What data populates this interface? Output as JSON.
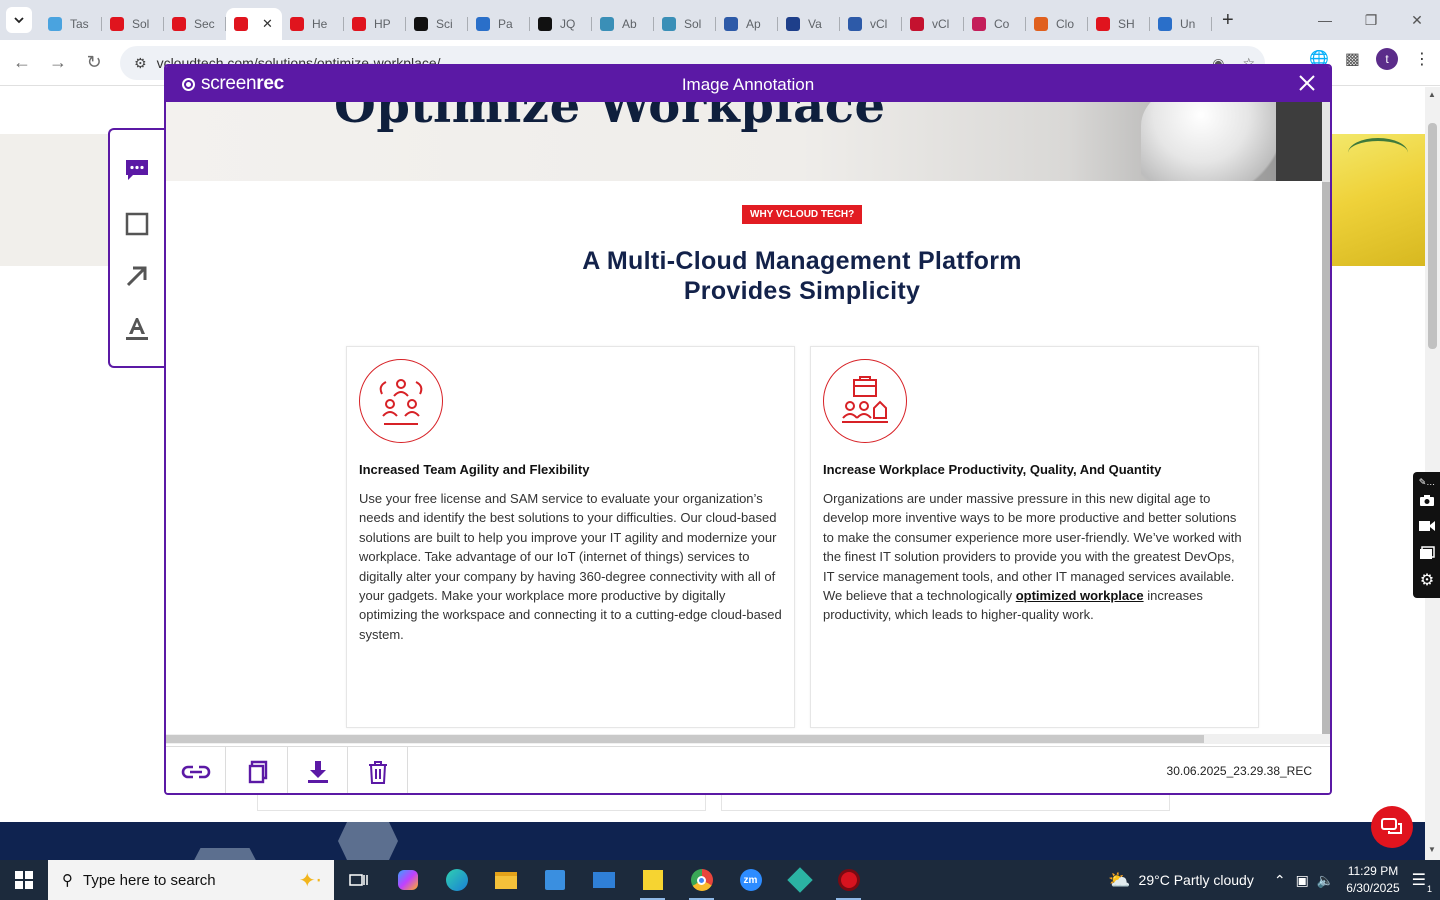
{
  "browser": {
    "tabs": [
      {
        "label": "Tas",
        "color": "#4aa3df"
      },
      {
        "label": "Sol",
        "color": "#e0141e"
      },
      {
        "label": "Sec",
        "color": "#e0141e"
      },
      {
        "label": "",
        "color": "#e0141e",
        "active": true
      },
      {
        "label": "He",
        "color": "#e0141e"
      },
      {
        "label": "HP",
        "color": "#e0141e"
      },
      {
        "label": "Sci",
        "color": "#111111"
      },
      {
        "label": "Pa",
        "color": "#2a6fc9"
      },
      {
        "label": "JQ",
        "color": "#111111"
      },
      {
        "label": "Ab",
        "color": "#3a8fb7"
      },
      {
        "label": "Sol",
        "color": "#3a8fb7"
      },
      {
        "label": "Ap",
        "color": "#2d5aa8"
      },
      {
        "label": "Va",
        "color": "#1e3f8a"
      },
      {
        "label": "vCl",
        "color": "#2d5aa8"
      },
      {
        "label": "vCl",
        "color": "#c4122f"
      },
      {
        "label": "Co",
        "color": "#c41e5a"
      },
      {
        "label": "Clo",
        "color": "#e0601e"
      },
      {
        "label": "SH",
        "color": "#e0141e"
      },
      {
        "label": "Un",
        "color": "#2a6fc9"
      }
    ],
    "url": "vcloudtech.com/solutions/optimize-workplace/",
    "profile_initial": "t"
  },
  "modal": {
    "logo_prefix": "screen",
    "logo_suffix": "rec",
    "title": "Image Annotation",
    "filename": "30.06.2025_23.29.38_REC"
  },
  "page": {
    "hero_title": "Optimize Workplace",
    "badge": "WHY VCLOUD TECH?",
    "heading_line1": "A Multi-Cloud Management Platform",
    "heading_line2": "Provides Simplicity",
    "cards": [
      {
        "title": "Increased Team Agility and Flexibility",
        "text": "Use your free license and SAM service to evaluate your organization’s needs and identify the best solutions to your difficulties. Our cloud-based solutions are built to help you improve your IT agility and modernize your workplace. Take advantage of our IoT (internet of things) services to digitally alter your company by having 360-degree connectivity with all of your gadgets. Make your workplace more productive by digitally optimizing the workspace and connecting it to a cutting-edge cloud-based system."
      },
      {
        "title": "Increase Workplace Productivity, Quality, And Quantity",
        "text_before": "Organizations are under massive pressure in this new digital age to develop more inventive ways to be more productive and better solutions to make the consumer experience more user-friendly. We’ve worked with the finest IT solution providers to provide you with the greatest DevOps, IT service management tools, and other IT managed services available. We believe that a technologically ",
        "link": "optimized workplace",
        "text_after": " increases productivity, which leads to higher-quality work."
      }
    ]
  },
  "taskbar": {
    "search_placeholder": "Type here to search",
    "weather": "29°C  Partly cloudy",
    "time": "11:29 PM",
    "date": "6/30/2025",
    "notification_count": "1"
  },
  "colors": {
    "modal_purple": "#5b19a5",
    "brand_red": "#e21c22",
    "heading_navy": "#13224a"
  }
}
